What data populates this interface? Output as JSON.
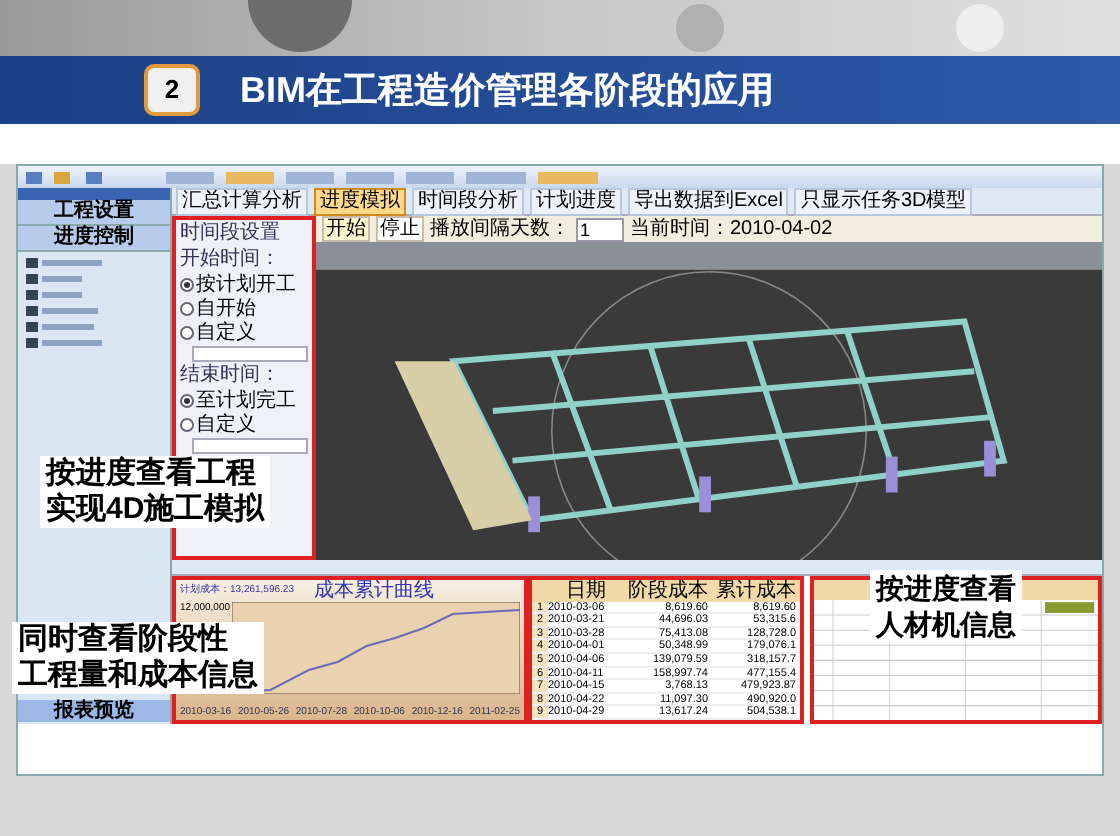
{
  "slide": {
    "badge": "2",
    "title": "BIM在工程造价管理各阶段的应用"
  },
  "toolbar": [
    {
      "label": "汇总计算分析",
      "selected": false
    },
    {
      "label": "进度模拟",
      "selected": true
    },
    {
      "label": "时间段分析",
      "selected": false
    },
    {
      "label": "计划进度",
      "selected": false
    },
    {
      "label": "导出数据到Excel",
      "selected": false
    },
    {
      "label": "只显示任务3D模型",
      "selected": false
    }
  ],
  "sidebar": {
    "sections": [
      "工程设置",
      "进度控制"
    ],
    "footer": "报表预览"
  },
  "time_panel": {
    "title": "时间段设置",
    "groups": [
      {
        "label": "开始时间：",
        "options": [
          {
            "label": "按计划开工",
            "selected": true
          },
          {
            "label": "自开始",
            "selected": false
          },
          {
            "label": "自定义",
            "selected": false
          }
        ]
      },
      {
        "label": "结束时间：",
        "options": [
          {
            "label": "至计划完工",
            "selected": true
          },
          {
            "label": "自定义",
            "selected": false
          }
        ]
      }
    ]
  },
  "playback": {
    "start": "开始",
    "stop": "停止",
    "interval_label": "播放间隔天数：",
    "interval": "1",
    "current_time": "当前时间：2010-04-02"
  },
  "chart_panel": {
    "plan_cost": "计划成本：13,261,596.23",
    "title": "成本累计曲线",
    "y_label": "12,000,000",
    "x_labels": [
      "2010-03-16",
      "2010-05-26",
      "2010-07-28",
      "2010-10-06",
      "2010-12-16",
      "2011-02-25"
    ]
  },
  "cost_table": {
    "columns": [
      "",
      "日期",
      "阶段成本",
      "累计成本"
    ],
    "rows": [
      [
        "1",
        "2010-03-06",
        "8,619.60",
        "8,619.60"
      ],
      [
        "2",
        "2010-03-21",
        "44,696.03",
        "53,315.6"
      ],
      [
        "3",
        "2010-03-28",
        "75,413.08",
        "128,728.0"
      ],
      [
        "4",
        "2010-04-01",
        "50,348.99",
        "179,076.1"
      ],
      [
        "5",
        "2010-04-06",
        "139,079.59",
        "318,157.7"
      ],
      [
        "6",
        "2010-04-11",
        "158,997.74",
        "477,155.4"
      ],
      [
        "7",
        "2010-04-15",
        "3,768.13",
        "479,923.87"
      ],
      [
        "8",
        "2010-04-22",
        "11,097.30",
        "490,920.0"
      ],
      [
        "9",
        "2010-04-29",
        "13,617.24",
        "504,538.1"
      ]
    ]
  },
  "callouts": [
    {
      "kind": "model",
      "lines": [
        "按进度查看工程",
        "实现4D施工模拟"
      ]
    },
    {
      "kind": "cost",
      "lines": [
        "同时查看阶段性",
        "工程量和成本信息"
      ]
    },
    {
      "kind": "resource",
      "lines": [
        "按进度查看",
        "人材机信息"
      ]
    }
  ]
}
